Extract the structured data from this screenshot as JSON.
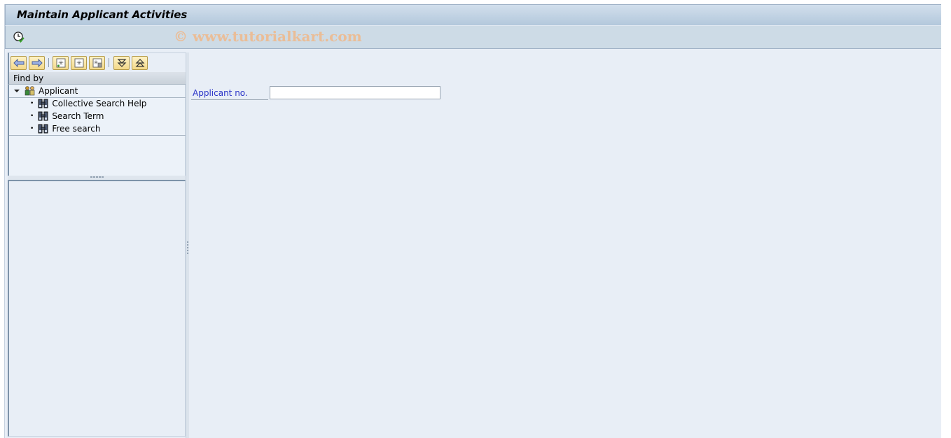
{
  "window": {
    "title": "Maintain Applicant Activities",
    "watermark": "© www.tutorialkart.com"
  },
  "appbar": {
    "execute_icon": "execute-clock-icon"
  },
  "navigator": {
    "toolbar": [
      {
        "name": "back",
        "icon": "arrow-left-icon"
      },
      {
        "name": "forward",
        "icon": "arrow-right-icon"
      },
      {
        "name": "new-search",
        "icon": "new-search-icon"
      },
      {
        "name": "edit-search",
        "icon": "edit-search-icon"
      },
      {
        "name": "delete-search",
        "icon": "delete-search-icon"
      },
      {
        "name": "expand",
        "icon": "expand-down-icon"
      },
      {
        "name": "collapse",
        "icon": "collapse-up-icon"
      }
    ],
    "find_by_label": "Find by",
    "tree": {
      "root": {
        "label": "Applicant",
        "icon": "applicant-group-icon",
        "expanded": true
      },
      "children": [
        {
          "label": "Collective Search Help",
          "icon": "binoculars-icon"
        },
        {
          "label": "Search Term",
          "icon": "binoculars-icon"
        },
        {
          "label": "Free search",
          "icon": "binoculars-icon"
        }
      ]
    }
  },
  "form": {
    "applicant_no_label": "Applicant no.",
    "applicant_no_value": ""
  },
  "colors": {
    "label_blue": "#2a34c7",
    "button_gold": "#f3d98a",
    "background": "#e8eef6"
  }
}
